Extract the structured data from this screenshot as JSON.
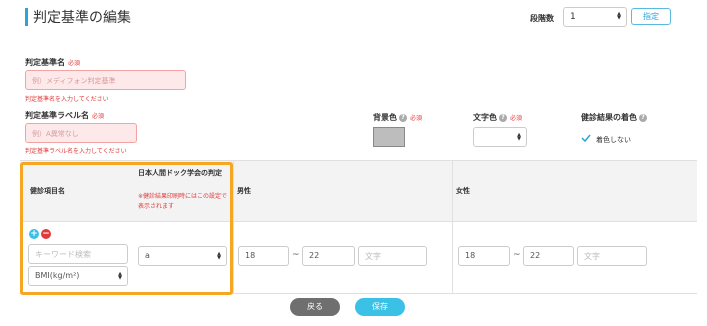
{
  "header": {
    "title": "判定基準の編集",
    "level_label": "段階数",
    "level_value": "1",
    "specify_button": "指定"
  },
  "form": {
    "required_tag": "必須",
    "name": {
      "label": "判定基準名",
      "placeholder": "例）メディフォン判定基準",
      "error": "判定基準名を入力してください"
    },
    "label_name": {
      "label": "判定基準ラベル名",
      "placeholder": "例）A異常なし",
      "error": "判定基準ラベル名を入力してください"
    },
    "bg_color": {
      "label": "背景色",
      "value": "#bdbdbd"
    },
    "text_color": {
      "label": "文字色"
    },
    "result_color": {
      "label": "健診結果の着色",
      "checkbox_label": "着色しない"
    }
  },
  "table": {
    "headers": {
      "item_name": "健診項目名",
      "jds": "日本人間ドック学会の判定",
      "jds_note": "※健診結果印刷時にはこの設定で表示されます",
      "male": "男性",
      "female": "女性"
    },
    "row": {
      "search_placeholder": "キーワード検索",
      "item_value": "BMI(kg/m²)",
      "jds_value": "a",
      "male_min": "18",
      "male_max": "22",
      "male_text_placeholder": "文字",
      "female_min": "18",
      "female_max": "22",
      "female_text_placeholder": "文字",
      "tilde": "~"
    }
  },
  "footer": {
    "back_button": "戻る",
    "save_button": "保存"
  },
  "colors": {
    "accent": "#2aa5d6",
    "required": "#e03b3b",
    "highlight": "#f5a623",
    "save": "#3bc0e6",
    "back": "#6f6f6f"
  }
}
